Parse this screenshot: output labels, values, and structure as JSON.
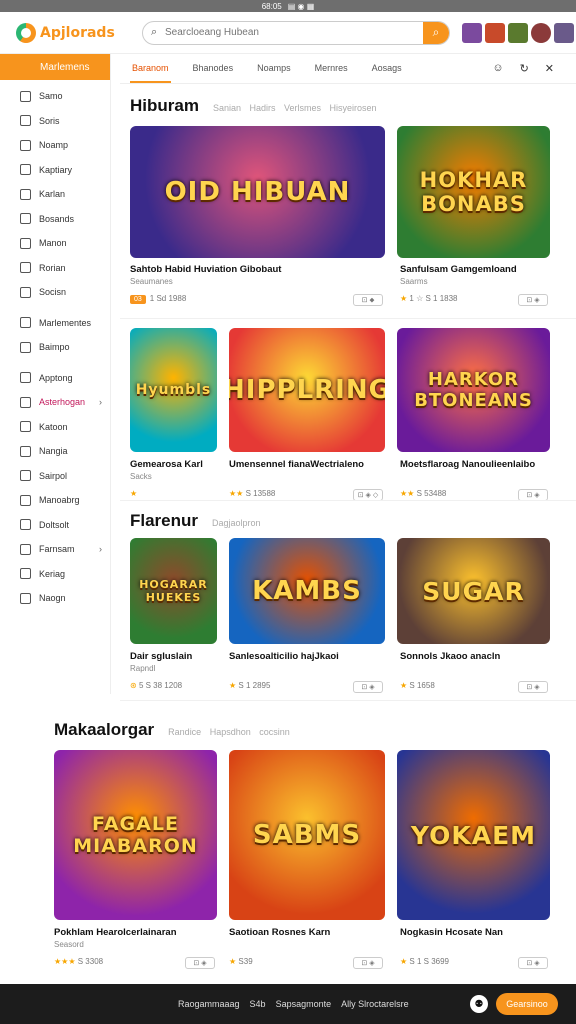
{
  "status": {
    "left": "68:05",
    "icons": "▤ ◉ ▦"
  },
  "header": {
    "logo_text": "Apjlorads",
    "search_placeholder": "Searcloeang Hubean",
    "search_value": "",
    "avatar_colors": [
      "#7b4a9e",
      "#c84a2a",
      "#5a7a2e",
      "#8b3a3a",
      "#6a5a8a"
    ]
  },
  "sidebar": {
    "active": "Marlemens",
    "items": [
      {
        "label": "Samo",
        "chev": ""
      },
      {
        "label": "Soris",
        "chev": ""
      },
      {
        "label": "Noamp",
        "chev": ""
      },
      {
        "label": "Kaptiary",
        "chev": ""
      },
      {
        "label": "Karlan",
        "chev": ""
      },
      {
        "label": "Bosands",
        "chev": ""
      },
      {
        "label": "Manon",
        "chev": ""
      },
      {
        "label": "Rorian",
        "chev": ""
      },
      {
        "label": "Socisn",
        "chev": ""
      },
      {
        "label": "Marlementes",
        "chev": ""
      },
      {
        "label": "Baimpo",
        "chev": ""
      },
      {
        "label": "Apptong",
        "chev": ""
      },
      {
        "label": "Asterhogan",
        "chev": "›",
        "hl": true
      },
      {
        "label": "Katoon",
        "chev": ""
      },
      {
        "label": "Nangia",
        "chev": ""
      },
      {
        "label": "Sairpol",
        "chev": ""
      },
      {
        "label": "Manoabrg",
        "chev": ""
      },
      {
        "label": "Doltsolt",
        "chev": ""
      },
      {
        "label": "Farnsam",
        "chev": "›"
      },
      {
        "label": "Keriag",
        "chev": ""
      },
      {
        "label": "Naogn",
        "chev": ""
      }
    ]
  },
  "tabs": {
    "items": [
      "Baranom",
      "Bhanodes",
      "Noamps",
      "Mernres",
      "Aosags"
    ],
    "active_index": 0,
    "icons": [
      "☺",
      "↻",
      "✕"
    ]
  },
  "sections": [
    {
      "title": "Hiburam",
      "subs": "Sanian Hadirs Verlsmes Hisyeirosen",
      "cards": [
        {
          "thumb": "OID HIBUAN",
          "title": "Sahtob Habid Huviation Gibobaut",
          "sub": "Seaumanes",
          "meta": "1 Sd 1988",
          "badge": "03",
          "pill": "⊡ ⬥",
          "colors": [
            "#3a2a8a",
            "#e0557a"
          ],
          "stars": ""
        },
        {
          "thumb": "HOKHAR BONABS",
          "title": "Sanfulsam Gamgemloand",
          "sub": "Saarms",
          "meta": "1 ☆ S 1 1838",
          "pill": "⊡ ◈",
          "colors": [
            "#2e7d32",
            "#f57c00"
          ],
          "stars": "★ "
        },
        {
          "thumb": "Hyumbls",
          "title": "Gemearosa Karl",
          "sub": "Sacks",
          "meta": "",
          "pill": "",
          "colors": [
            "#00acc1",
            "#ffb300"
          ],
          "stars": "★"
        },
        {
          "thumb": "HIPPLRING",
          "title": "Umensennel fianaWectrialeno",
          "sub": "",
          "meta": "S 13588",
          "pill": "⊡ ◈ ◇",
          "colors": [
            "#e53935",
            "#fdd835"
          ],
          "stars": "★★ "
        },
        {
          "thumb": "HARKOR BTONEANS",
          "title": "Moetsflaroag Nanoulieenlaibo",
          "sub": "",
          "meta": "S 53488",
          "pill": "⊡ ◈",
          "colors": [
            "#6a1b9a",
            "#ff7043"
          ],
          "stars": "★★ "
        }
      ]
    },
    {
      "title": "Flarenur",
      "subs": "Dagjaolpron",
      "cards": [
        {
          "thumb": "HOGARAR HUEKES",
          "title": "Dair sgluslain",
          "sub": "Rapndl",
          "meta": "5 S 38 1208",
          "pill": "",
          "colors": [
            "#2e7d32",
            "#8d4a2a"
          ],
          "stars": "⊛ "
        },
        {
          "thumb": "KAMBS",
          "title": "Sanlesoalticilio hajJkaoi",
          "sub": "",
          "meta": "S 1 2895",
          "pill": "⊡ ◈",
          "colors": [
            "#1565c0",
            "#e65100"
          ],
          "stars": "★ "
        },
        {
          "thumb": "SUGAR",
          "title": "Sonnols Jkaoo anacln",
          "sub": "",
          "meta": "S 1658",
          "pill": "⊡ ◈",
          "colors": [
            "#5d4037",
            "#fbc02d"
          ],
          "stars": "★ "
        }
      ]
    },
    {
      "title": "Makaalorgar",
      "subs": "Randice Hapsdhon  cocsinn",
      "cards": [
        {
          "thumb": "FAGALE MIABARON",
          "title": "Pokhlam Hearolcerlainaran",
          "sub": "Seasord",
          "meta": "S 3308",
          "pill": "⊡ ◈",
          "colors": [
            "#8e24aa",
            "#ff8f00"
          ],
          "stars": "★★★ "
        },
        {
          "thumb": "SABMS",
          "title": "Saotioan Rosnes Karn",
          "sub": "",
          "meta": "S39",
          "pill": "⊡ ◈",
          "colors": [
            "#d84315",
            "#fbc02d"
          ],
          "stars": "★ "
        },
        {
          "thumb": "YOKAEM",
          "title": "Nogkasin Hcosate Nan",
          "sub": "",
          "meta": "S 1 S 3699",
          "pill": "⊡ ◈",
          "colors": [
            "#283593",
            "#ef6c00"
          ],
          "stars": "★ "
        }
      ]
    }
  ],
  "footer": {
    "links": [
      "Raogammaaag",
      "S4b",
      "Sapsagmonte",
      "Ally Slroctarelsre"
    ],
    "icon": "⚉",
    "button": "Gearsinoo"
  }
}
